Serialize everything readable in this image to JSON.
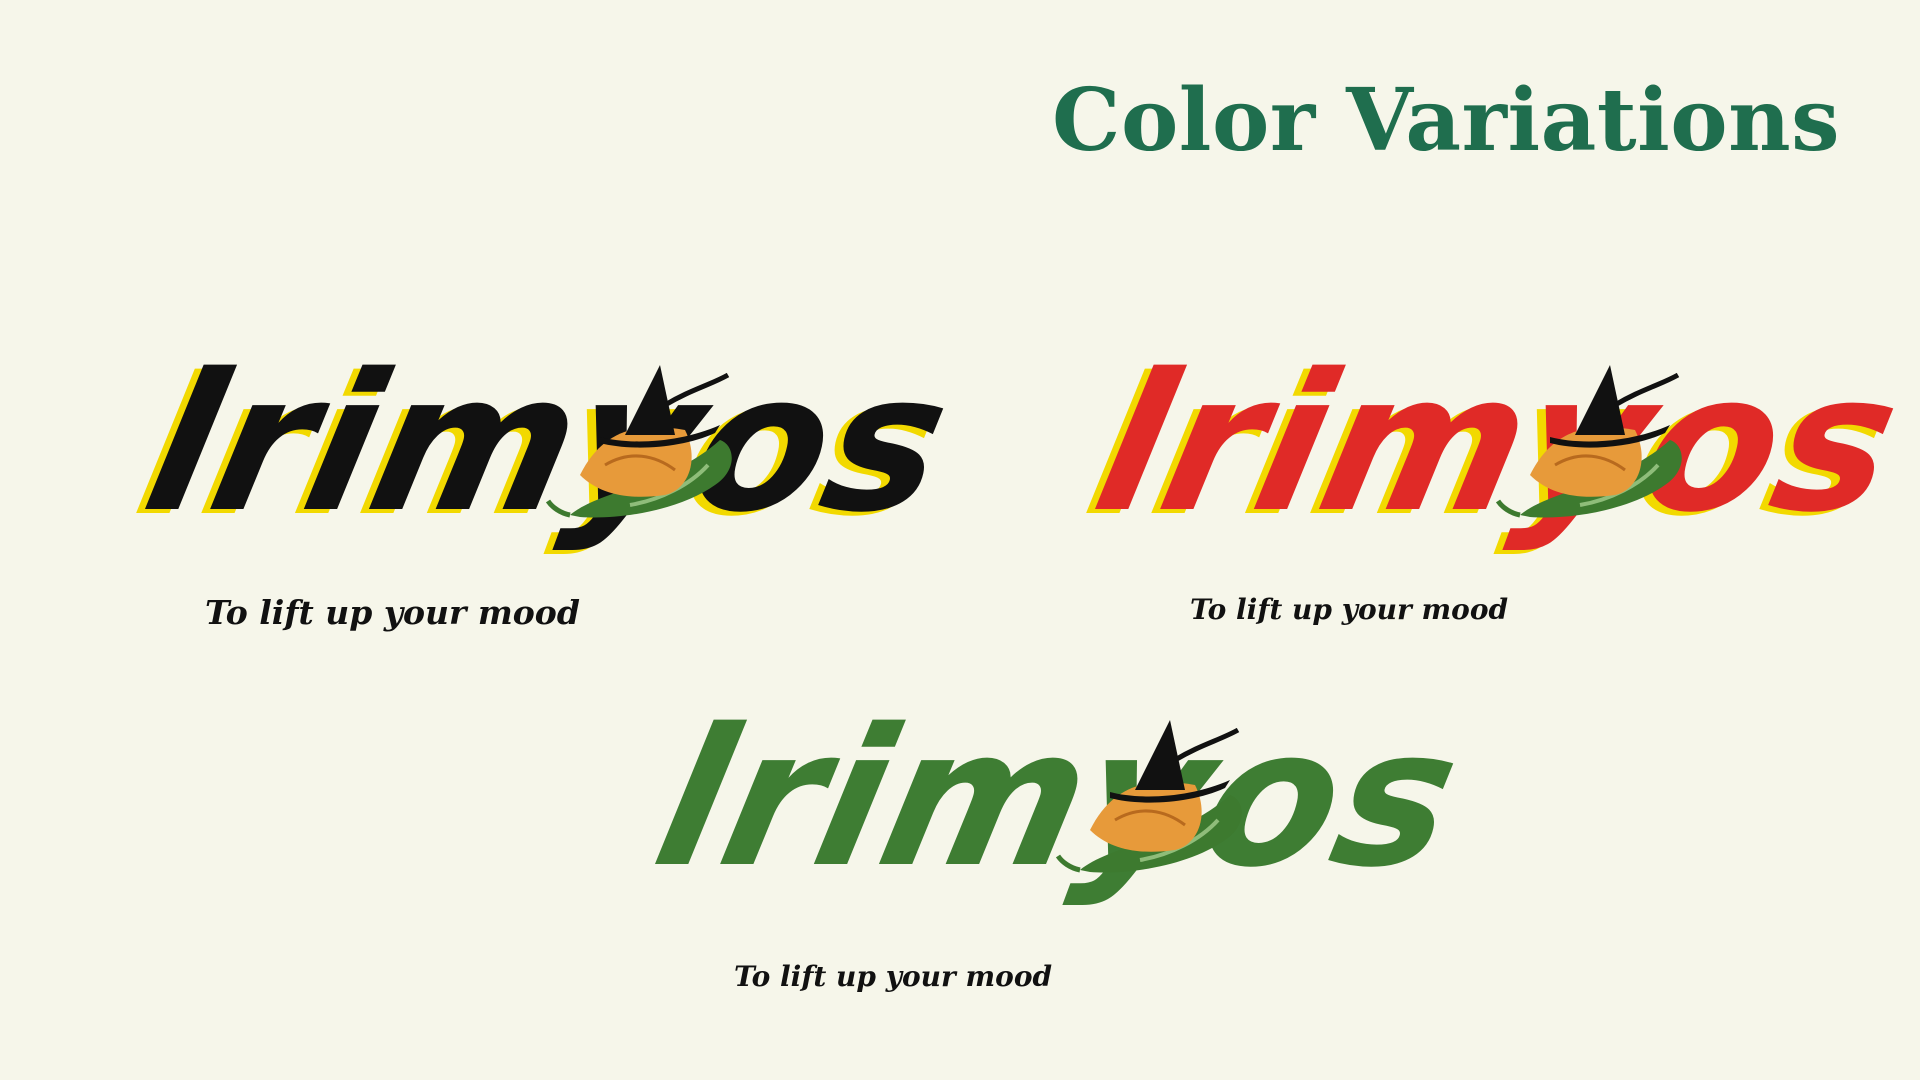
{
  "page": {
    "title": "Color Variations",
    "background": "#f6f6ea",
    "title_color": "#1f6e4e"
  },
  "logos": [
    {
      "variant": "black",
      "wordmark": "lrimyos",
      "tagline": "To lift up your mood",
      "letter_fill": "#111111",
      "letter_shadow": "#f2d900"
    },
    {
      "variant": "red",
      "wordmark": "lrimyos",
      "tagline": "To lift up your mood",
      "letter_fill": "#e02a27",
      "letter_shadow": "#f2d900"
    },
    {
      "variant": "green",
      "wordmark": "lrimyos",
      "tagline": "To lift up your mood",
      "letter_fill": "#3e7d33",
      "letter_shadow": "none"
    }
  ],
  "icons": {
    "pepper": "green-chili-pepper-icon",
    "hat": "witch-hat-icon",
    "samosa": "samosa-icon"
  }
}
